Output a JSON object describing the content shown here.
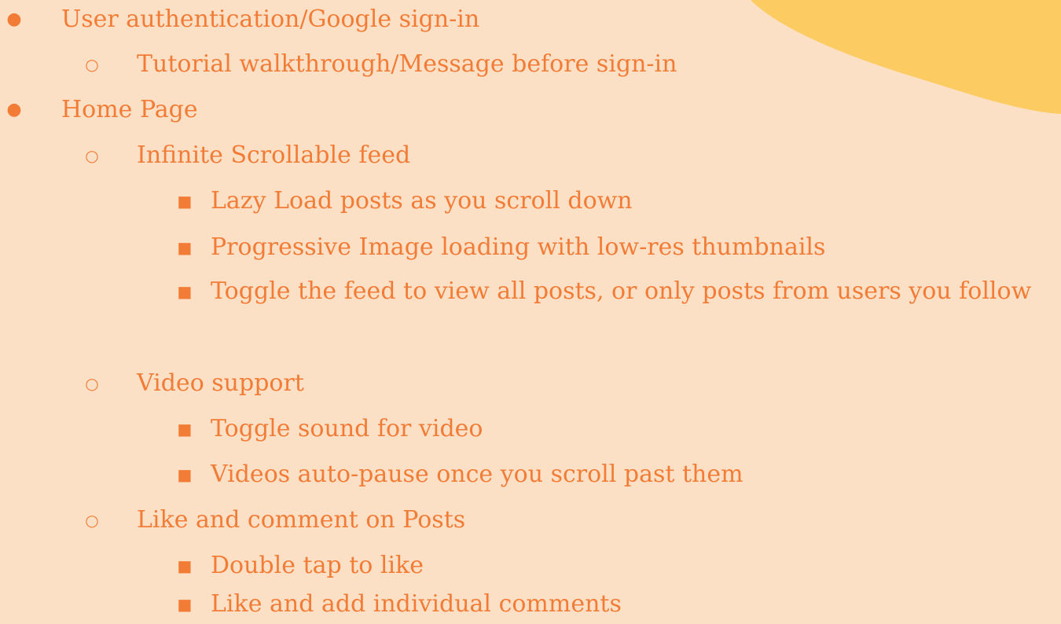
{
  "theme": {
    "background": "#fce0c6",
    "text_color": "#f27c36",
    "blob_color": "#fccc63"
  },
  "icons": {
    "level1": "filled-circle-bullet",
    "level2": "hollow-circle-bullet",
    "level3": "filled-square-bullet"
  },
  "bullets": {
    "level1": "●",
    "level2": "○",
    "level3": "■"
  },
  "items": [
    {
      "level": 1,
      "text": "User authentication/Google sign-in"
    },
    {
      "level": 2,
      "text": "Tutorial walkthrough/Message before sign-in"
    },
    {
      "level": 1,
      "text": "Home Page"
    },
    {
      "level": 2,
      "text": "Infinite Scrollable feed"
    },
    {
      "level": 3,
      "text": "Lazy Load posts as you scroll down"
    },
    {
      "level": 3,
      "text": "Progressive Image loading with low-res thumbnails"
    },
    {
      "level": 3,
      "text": "Toggle the feed to view all posts, or only posts from users you follow"
    },
    {
      "level": 2,
      "text": "Video support"
    },
    {
      "level": 3,
      "text": "Toggle sound for video"
    },
    {
      "level": 3,
      "text": "Videos auto-pause once you scroll past them"
    },
    {
      "level": 2,
      "text": "Like and comment on Posts"
    },
    {
      "level": 3,
      "text": "Double tap to like"
    },
    {
      "level": 3,
      "text": "Like and add individual comments"
    }
  ]
}
